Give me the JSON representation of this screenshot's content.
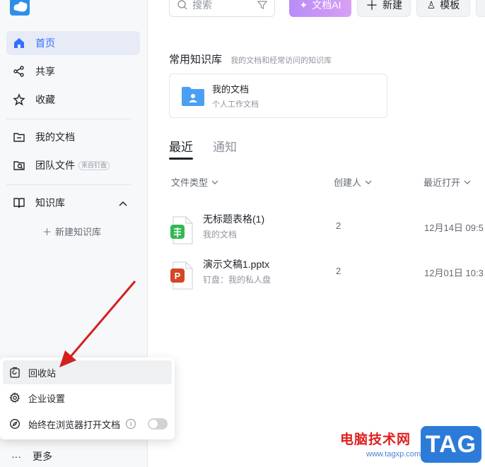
{
  "sidebar": {
    "items": [
      {
        "label": "首页",
        "icon": "home-icon",
        "active": true
      },
      {
        "label": "共享",
        "icon": "share-icon"
      },
      {
        "label": "收藏",
        "icon": "star-icon"
      },
      {
        "label": "我的文档",
        "icon": "folder-icon"
      },
      {
        "label": "团队文件",
        "icon": "team-folder-icon",
        "badge": "来自钉盘"
      },
      {
        "label": "知识库",
        "icon": "book-icon"
      }
    ],
    "new_kb": "新建知识库",
    "more": "更多"
  },
  "toolbar": {
    "search_placeholder": "搜索",
    "ai_label": "文档AI",
    "new_label": "新建",
    "template_label": "模板"
  },
  "main": {
    "common_title": "常用知识库",
    "common_sub": "我的文档和经常访问的知识库",
    "kb_card": {
      "title": "我的文档",
      "subtitle": "个人工作文档"
    },
    "tabs": [
      {
        "label": "最近",
        "active": true
      },
      {
        "label": "通知"
      }
    ],
    "columns": [
      "文件类型",
      "创建人",
      "最近打开"
    ],
    "files": [
      {
        "name": "无标题表格(1)",
        "location": "我的文档",
        "creator": "2",
        "time": "12月14日 09:5",
        "icon": "sheet-file-icon"
      },
      {
        "name": "演示文稿1.pptx",
        "location": "钉盘：我的私人盘",
        "creator": "2",
        "time": "12月01日 10:3",
        "icon": "ppt-file-icon"
      }
    ]
  },
  "popup": {
    "items": [
      {
        "label": "回收站",
        "icon": "recycle-bin-icon"
      },
      {
        "label": "企业设置",
        "icon": "gear-icon"
      },
      {
        "label": "始终在浏览器打开文档",
        "icon": "compass-icon",
        "toggle": false
      }
    ]
  },
  "watermark": {
    "text": "电脑技术网",
    "url": "www.tagxp.com",
    "badge": "TAG"
  },
  "colors": {
    "accent": "#3370ff",
    "ai_gradient_start": "#b98cf7",
    "arrow": "#d42020"
  }
}
